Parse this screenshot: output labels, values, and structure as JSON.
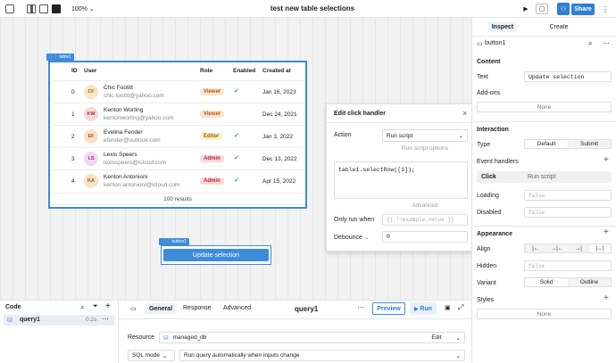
{
  "topbar": {
    "zoom": "100%",
    "title": "test new table selections",
    "share_label": "Share"
  },
  "table": {
    "tag": "table1",
    "headers": [
      "ID",
      "User",
      "Role",
      "Enabled",
      "Created at"
    ],
    "rows": [
      {
        "id": "0",
        "initials": "CF",
        "name": "Chic Footitt",
        "email": "chic.footitt@yahoo.com",
        "role": "Viewer",
        "enabled": true,
        "created": "Jan 16, 2023",
        "avatar_bg": "#f7e7c4",
        "avatar_fg": "#9a6a10",
        "role_bg": "#fbe5cf",
        "role_fg": "#b55a12"
      },
      {
        "id": "1",
        "initials": "KW",
        "name": "Kenton Worling",
        "email": "kentonworling@yahoo.com",
        "role": "Viewer",
        "enabled": false,
        "created": "Dec 24, 2021",
        "avatar_bg": "#f8d9dc",
        "avatar_fg": "#a8323e",
        "role_bg": "#fbe5cf",
        "role_fg": "#b55a12"
      },
      {
        "id": "2",
        "initials": "EF",
        "name": "Evelina Fender",
        "email": "efender@outlook.com",
        "role": "Editor",
        "enabled": true,
        "created": "Jan 3, 2022",
        "avatar_bg": "#fbe2cf",
        "avatar_fg": "#a45116",
        "role_bg": "#fbefc3",
        "role_fg": "#8a6a06"
      },
      {
        "id": "3",
        "initials": "LS",
        "name": "Lexis Speers",
        "email": "lexisspeers@icloud.com",
        "role": "Admin",
        "enabled": true,
        "created": "Dec 13, 2022",
        "avatar_bg": "#f5d8ef",
        "avatar_fg": "#9b2e86",
        "role_bg": "#f9d9d9",
        "role_fg": "#b3263a"
      },
      {
        "id": "4",
        "initials": "KA",
        "name": "Kenton Antonioni",
        "email": "kenton.antonioni@icloud.com",
        "role": "Admin",
        "enabled": true,
        "created": "Apr 15, 2022",
        "avatar_bg": "#f7e3c6",
        "avatar_fg": "#9a5c0f",
        "role_bg": "#f9d9d9",
        "role_fg": "#b3263a"
      }
    ],
    "footer": "100 results"
  },
  "button_widget": {
    "tag": "button1",
    "label": "Update selection"
  },
  "popup": {
    "title": "Edit click handler",
    "action_label": "Action",
    "action_value": "Run script",
    "options_divider": "Run script options",
    "code": "table1.selectRow([1]);",
    "advanced_divider": "Advanced",
    "only_run_label": "Only run when",
    "only_run_placeholder": "{{ !!example.value }}",
    "debounce_label": "Debounce",
    "debounce_value": "0"
  },
  "inspector": {
    "tabs": [
      "Inspect",
      "Create"
    ],
    "component": "button1",
    "content_header": "Content",
    "text_label": "Text",
    "text_value": "Update selection",
    "addons_label": "Add-ons",
    "addons_value": "None",
    "interaction_header": "Interaction",
    "type_label": "Type",
    "type_options": [
      "Default",
      "Submit"
    ],
    "event_handlers_label": "Event handlers",
    "event_name": "Click",
    "event_action": "Run script",
    "loading_label": "Loading",
    "loading_placeholder": "false",
    "disabled_label": "Disabled",
    "disabled_placeholder": "false",
    "appearance_header": "Appearance",
    "align_label": "Align",
    "hidden_label": "Hidden",
    "hidden_placeholder": "false",
    "variant_label": "Variant",
    "variant_options": [
      "Solid",
      "Outline"
    ],
    "styles_label": "Styles",
    "styles_value": "None"
  },
  "code_panel": {
    "title": "Code",
    "query_name": "query1",
    "query_time": "0.2s"
  },
  "query_editor": {
    "tabs": [
      "General",
      "Response",
      "Advanced"
    ],
    "query_title": "query1",
    "preview_label": "Preview",
    "run_label": "Run",
    "resource_label": "Resource",
    "resource_value": "managed_db",
    "edit_label": "Edit",
    "mode_label": "SQL mode",
    "run_mode_value": "Run query automatically when inputs change"
  },
  "colors": {
    "accent": "#3d8bd9",
    "share": "#2f7fd6"
  }
}
